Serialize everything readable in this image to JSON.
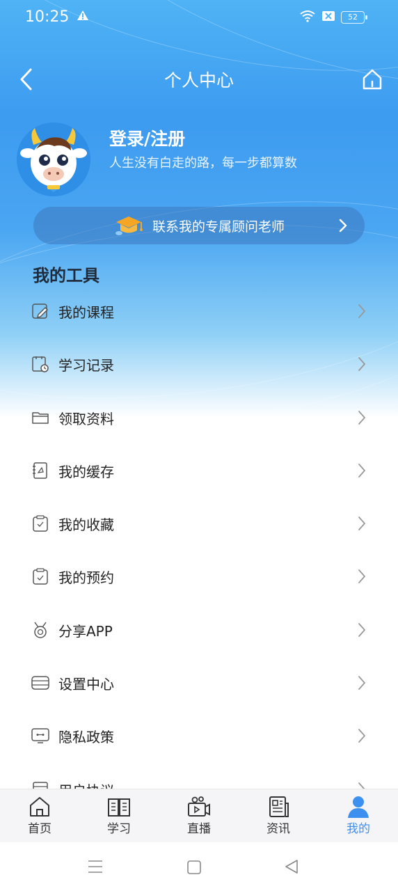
{
  "status": {
    "time": "10:25",
    "battery": "52"
  },
  "header": {
    "title": "个人中心"
  },
  "user": {
    "name": "登录/注册",
    "motto": "人生没有白走的路，每一步都算数"
  },
  "advisor": {
    "label": "联系我的专属顾问老师"
  },
  "tools": {
    "title": "我的工具",
    "items": [
      {
        "label": "我的课程",
        "icon": "course-icon"
      },
      {
        "label": "学习记录",
        "icon": "study-record-icon"
      },
      {
        "label": "领取资料",
        "icon": "folder-icon"
      },
      {
        "label": "我的缓存",
        "icon": "cache-icon"
      },
      {
        "label": "我的收藏",
        "icon": "favorite-icon"
      },
      {
        "label": "我的预约",
        "icon": "reservation-icon"
      },
      {
        "label": "分享APP",
        "icon": "share-icon"
      },
      {
        "label": "设置中心",
        "icon": "settings-icon"
      },
      {
        "label": "隐私政策",
        "icon": "privacy-icon"
      },
      {
        "label": "用户协议",
        "icon": "agreement-icon"
      }
    ]
  },
  "tabbar": {
    "active": "我的",
    "accent": "#3d8ff0",
    "tabs": [
      {
        "label": "首页"
      },
      {
        "label": "学习"
      },
      {
        "label": "直播"
      },
      {
        "label": "资讯"
      },
      {
        "label": "我的"
      }
    ]
  }
}
